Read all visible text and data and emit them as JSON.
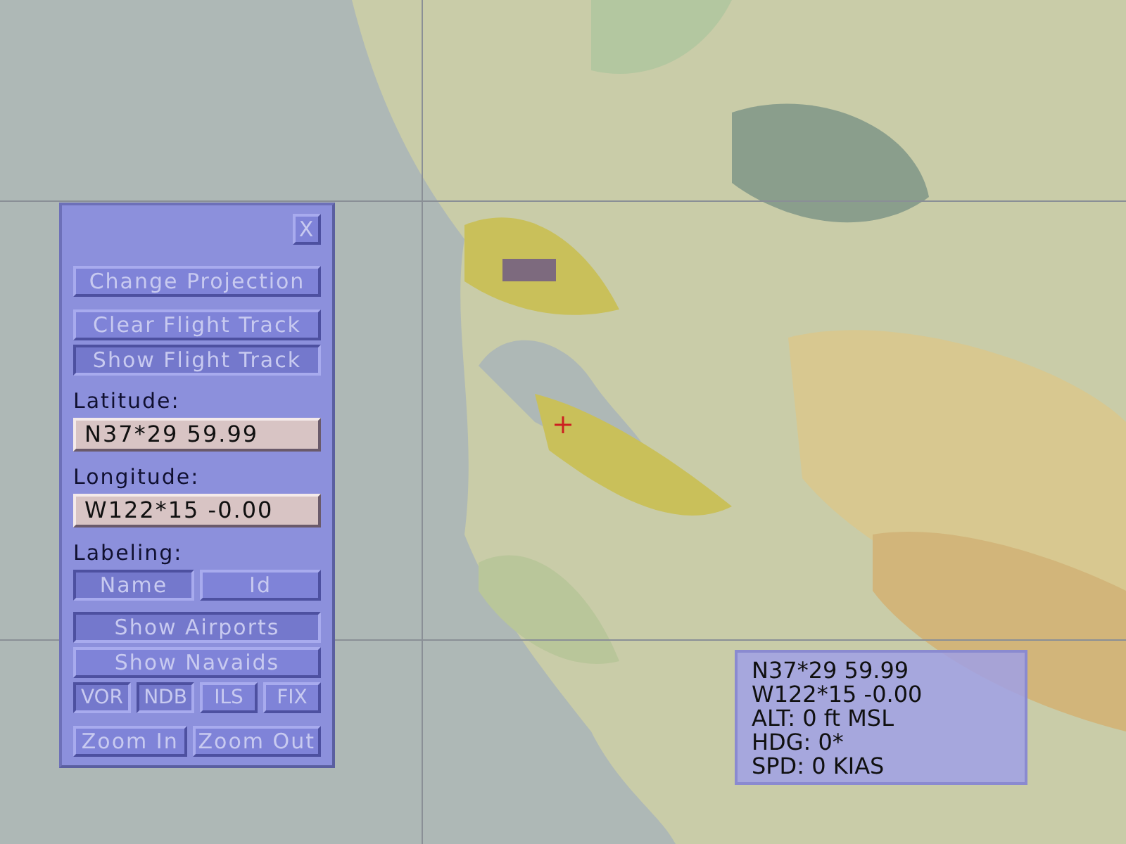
{
  "panel": {
    "close": "X",
    "actions": [
      [
        {
          "label": "Change Projection",
          "pressed": false
        }
      ],
      [
        {
          "label": "Clear Flight Track",
          "pressed": false
        },
        {
          "label": "Show Flight Track",
          "pressed": true
        }
      ]
    ],
    "latitude": {
      "label": "Latitude:",
      "value": "N37*29 59.99"
    },
    "longitude": {
      "label": "Longitude:",
      "value": "W122*15 -0.00"
    },
    "labeling": {
      "label": "Labeling:",
      "options": [
        {
          "label": "Name",
          "pressed": true
        },
        {
          "label": "Id",
          "pressed": false
        }
      ]
    },
    "toggles": [
      {
        "label": "Show Airports",
        "pressed": true
      },
      {
        "label": "Show Navaids",
        "pressed": false
      }
    ],
    "navaids": [
      {
        "label": "VOR",
        "pressed": true
      },
      {
        "label": "NDB",
        "pressed": true
      },
      {
        "label": "ILS",
        "pressed": false
      },
      {
        "label": "FIX",
        "pressed": false
      }
    ],
    "zoom": [
      {
        "label": "Zoom In",
        "pressed": false
      },
      {
        "label": "Zoom Out",
        "pressed": false
      }
    ]
  },
  "info": [
    "N37*29 59.99",
    "W122*15 -0.00",
    "ALT: 0 ft MSL",
    "HDG: 0*",
    "SPD: 0 KIAS"
  ]
}
